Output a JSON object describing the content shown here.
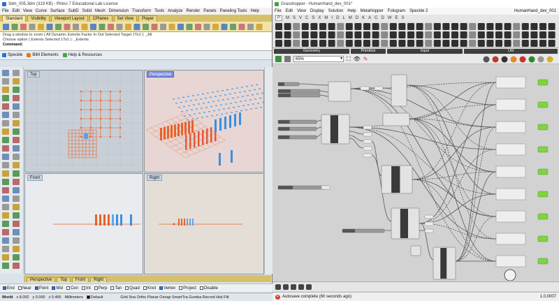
{
  "rhino": {
    "title": "3dm_005.3dm (319 KB) - Rhino 7 Educational Lab License",
    "menu": [
      "File",
      "Edit",
      "View",
      "Curve",
      "Surface",
      "SubD",
      "Solid",
      "Mesh",
      "Dimension",
      "Transform",
      "Tools",
      "Analyze",
      "Render",
      "Panels",
      "Paneling Tools",
      "Help"
    ],
    "tabs": [
      "Standard",
      "Visibility",
      "Viewport Layout",
      "CPlanes",
      "Set View",
      "Player"
    ],
    "command_history": [
      "Drag a window to zoom ( All  Dynamic  Extents  Factor  In  Out  Selected  Target  1To1 ): _All",
      "Choose option ( Extents  Selected  1To1 ): _Extents"
    ],
    "command_label": "Command:",
    "plugins": [
      "Speckle",
      "BIM Elements",
      "Help & Resources"
    ],
    "viewports": {
      "top": "Top",
      "perspective": "Perspective",
      "front": "Front",
      "right": "Right"
    },
    "viewport_tabs": [
      "Perspective",
      "Top",
      "Front",
      "Right"
    ],
    "osnaps": [
      {
        "label": "End",
        "on": true
      },
      {
        "label": "Near",
        "on": false
      },
      {
        "label": "Point",
        "on": true
      },
      {
        "label": "Mid",
        "on": true
      },
      {
        "label": "Cen",
        "on": false
      },
      {
        "label": "Int",
        "on": false
      },
      {
        "label": "Perp",
        "on": false
      },
      {
        "label": "Tan",
        "on": false
      },
      {
        "label": "Quad",
        "on": false
      },
      {
        "label": "Knot",
        "on": false
      },
      {
        "label": "Vertex",
        "on": true
      },
      {
        "label": "Project",
        "on": false
      },
      {
        "label": "Disable",
        "on": false
      }
    ],
    "status": {
      "cplane": "World",
      "x": "x 8.092",
      "y": "y 0.000",
      "z": "z 5.465",
      "units": "Millimeters",
      "layer": "Default",
      "toggles": "Grid Sna Ortho Planar Osnap SmartTra Gumba Record Hist Filt"
    }
  },
  "gh": {
    "title": "Grasshopper - HumanHand_dev_001*",
    "doc": "HumanHand_dev_001",
    "menu": [
      "File",
      "Edit",
      "View",
      "Display",
      "Solution",
      "Help",
      "MetaHopper",
      "Fologram",
      "Speckle 2"
    ],
    "tabs": [
      "P",
      "M",
      "S",
      "V",
      "C",
      "S",
      "X",
      "M",
      "I",
      "D",
      "L",
      "M",
      "D",
      "K",
      "A",
      "C",
      "D",
      "W",
      "E",
      "S"
    ],
    "groups": [
      "Geometry",
      "Primitive",
      "Input",
      "Util"
    ],
    "zoom": "65%",
    "autosave": "Autosave complete (60 seconds ago)",
    "version": "1.0.0007"
  },
  "colors": {
    "accent_orange": "#e8622a",
    "accent_blue": "#3a8fe0",
    "gh_green": "#7fd442",
    "rhino_tab": "#d6c06a"
  }
}
